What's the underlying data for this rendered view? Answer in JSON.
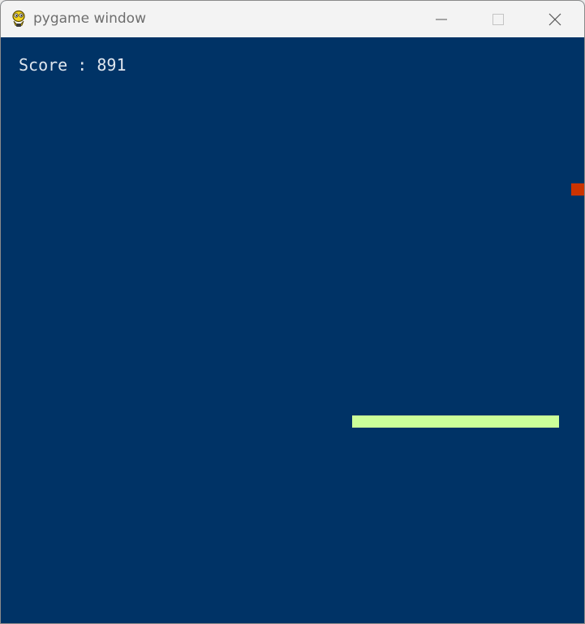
{
  "window": {
    "title": "pygame window",
    "app_icon": "pygame-snake-icon",
    "controls": {
      "minimize_icon": "minimize-icon",
      "maximize_icon": "maximize-icon",
      "close_icon": "close-icon"
    }
  },
  "game": {
    "background_color": "#003366",
    "score_label": "Score",
    "score_separator": ":",
    "score_value": "891",
    "paddle_color": "#ccff99",
    "ball_color": "#cc3300"
  }
}
